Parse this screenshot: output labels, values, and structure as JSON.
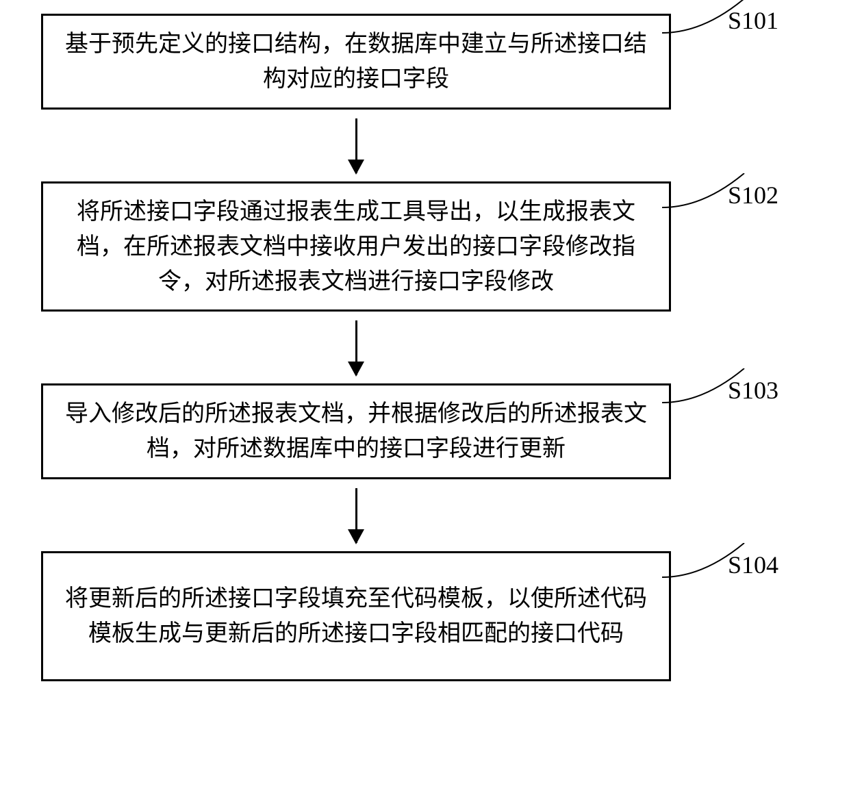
{
  "flowchart": {
    "steps": [
      {
        "id": "S101",
        "text": "基于预先定义的接口结构，在数据库中建立与所述接口结构对应的接口字段"
      },
      {
        "id": "S102",
        "text": "将所述接口字段通过报表生成工具导出，以生成报表文档，在所述报表文档中接收用户发出的接口字段修改指令，对所述报表文档进行接口字段修改"
      },
      {
        "id": "S103",
        "text": "导入修改后的所述报表文档，并根据修改后的所述报表文档，对所述数据库中的接口字段进行更新"
      },
      {
        "id": "S104",
        "text": "将更新后的所述接口字段填充至代码模板，以使所述代码模板生成与更新后的所述接口字段相匹配的接口代码"
      }
    ]
  }
}
